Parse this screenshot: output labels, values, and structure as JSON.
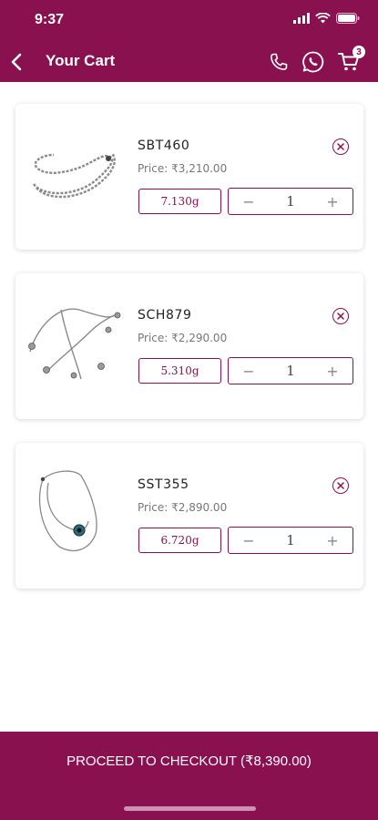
{
  "status": {
    "time": "9:37"
  },
  "header": {
    "title": "Your Cart",
    "cart_count": "3"
  },
  "items": [
    {
      "sku": "SBT460",
      "price": "Price: ₹3,210.00",
      "weight": "7.130g",
      "qty": "1"
    },
    {
      "sku": "SCH879",
      "price": "Price: ₹2,290.00",
      "weight": "5.310g",
      "qty": "1"
    },
    {
      "sku": "SST355",
      "price": "Price: ₹2,890.00",
      "weight": "6.720g",
      "qty": "1"
    }
  ],
  "stepper": {
    "minus": "−",
    "plus": "+"
  },
  "checkout": {
    "label": "PROCEED TO CHECKOUT (₹8,390.00)"
  },
  "colors": {
    "primary": "#8a1150",
    "background": "#ffffff"
  }
}
